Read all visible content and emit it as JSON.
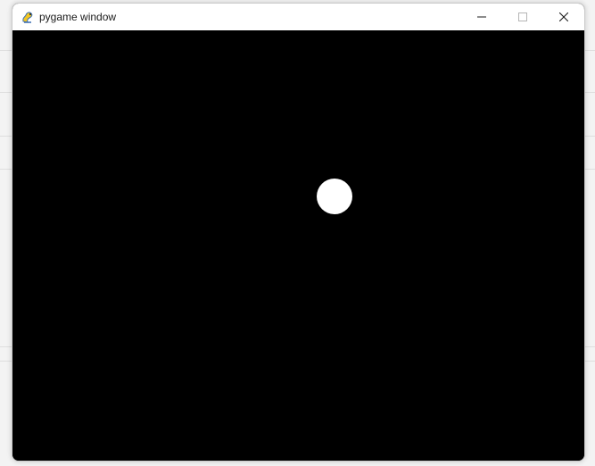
{
  "window": {
    "title": "pygame window",
    "icon": "pygame-snake-icon",
    "controls": {
      "minimize_icon": "minimize-icon",
      "maximize_icon": "maximize-icon",
      "close_icon": "close-icon"
    }
  },
  "canvas": {
    "background_color": "#000000",
    "objects": [
      {
        "type": "circle",
        "name": "ball",
        "color": "#ffffff"
      }
    ]
  }
}
